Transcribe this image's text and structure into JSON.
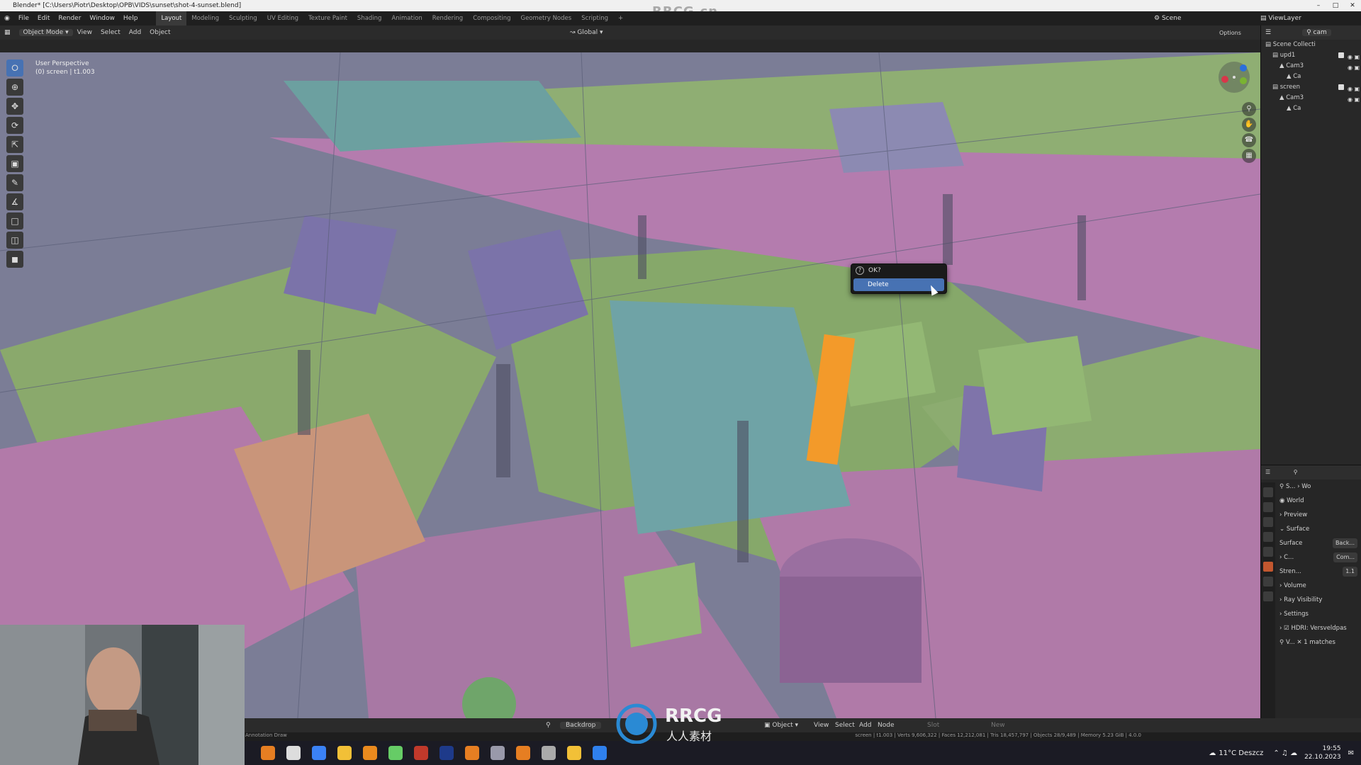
{
  "window": {
    "title": "Blender* [C:\\Users\\Piotr\\Desktop\\OPB\\VIDS\\sunset\\shot-4-sunset.blend]",
    "watermark": "RRCG.cn"
  },
  "menu": {
    "items": [
      "File",
      "Edit",
      "Render",
      "Window",
      "Help"
    ],
    "workspaces": [
      "Layout",
      "Modeling",
      "Sculpting",
      "UV Editing",
      "Texture Paint",
      "Shading",
      "Animation",
      "Rendering",
      "Compositing",
      "Geometry Nodes",
      "Scripting",
      "+"
    ],
    "active_workspace": "Layout",
    "scene": "Scene",
    "view_layer": "ViewLayer"
  },
  "header": {
    "mode": "Object Mode",
    "items": [
      "View",
      "Select",
      "Add",
      "Object"
    ],
    "orientation": "Global",
    "options": "Options"
  },
  "viewport": {
    "perspective": "User Perspective",
    "collection_line": "(0) screen | t1.003"
  },
  "popup": {
    "title": "OK?",
    "button": "Delete"
  },
  "outliner": {
    "search": "cam",
    "rows": [
      {
        "label": "Scene Collecti",
        "indent": 0,
        "selected": false
      },
      {
        "label": "upd1",
        "indent": 1,
        "selected": false
      },
      {
        "label": "Cam3",
        "indent": 2,
        "selected": false
      },
      {
        "label": "Ca",
        "indent": 3,
        "selected": false
      },
      {
        "label": "screen",
        "indent": 1,
        "selected": false
      },
      {
        "label": "Cam3",
        "indent": 2,
        "selected": false
      },
      {
        "label": "Ca",
        "indent": 3,
        "selected": false
      }
    ]
  },
  "properties": {
    "breadcrumb": [
      "S...",
      "Wo"
    ],
    "world_name": "World",
    "rows": [
      {
        "label": "Preview",
        "value": ""
      },
      {
        "label": "Surface",
        "value": ""
      },
      {
        "label": "Surface",
        "value": "Back..."
      },
      {
        "label": "C...",
        "value": "Com..."
      },
      {
        "label": "Stren...",
        "value": "1.1"
      },
      {
        "label": "Volume",
        "value": ""
      },
      {
        "label": "Ray Visibility",
        "value": ""
      },
      {
        "label": "Settings",
        "value": ""
      },
      {
        "label": "HDRI: Versveldpas",
        "value": ""
      }
    ],
    "search_result": "1 matches",
    "search_value": "V..."
  },
  "bottom_header": {
    "backdrop": "Backdrop",
    "object": "Object",
    "items": [
      "View",
      "Select",
      "Add",
      "Node"
    ],
    "slot": "Slot",
    "new": "New"
  },
  "status": {
    "left": "Annotation Draw",
    "right": "screen | t1.003 | Verts 9,606,322 | Faces 12,212,081 | Tris 18,457,797 | Objects 28/9,489 | Memory 5.23 GiB | 4.0.0"
  },
  "taskbar": {
    "weather": "11°C Deszcz",
    "time": "19:55",
    "date": "22.10.2023"
  },
  "logo_text": "RRCG",
  "logo_sub": "人人素材",
  "colors": {
    "accent": "#4772b3",
    "magenta": "#b07aa8",
    "green": "#8ab06a",
    "teal": "#6ea3a2",
    "purple": "#7a72a8",
    "orange": "#f39a2a"
  }
}
